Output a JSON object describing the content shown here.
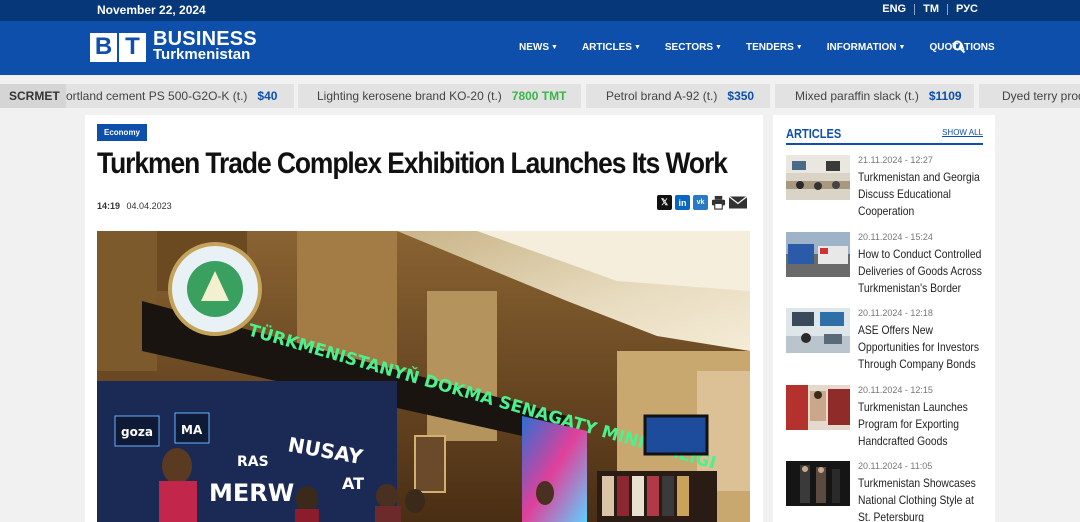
{
  "topbar": {
    "date": "November 22, 2024",
    "languages": [
      "ENG",
      "TM",
      "РУС"
    ]
  },
  "header": {
    "logo_mark": [
      "B",
      "T"
    ],
    "logo_line1": "BUSINESS",
    "logo_line2": "Turkmenistan",
    "nav": [
      {
        "label": "NEWS",
        "dropdown": true
      },
      {
        "label": "ARTICLES",
        "dropdown": true
      },
      {
        "label": "SECTORS",
        "dropdown": true
      },
      {
        "label": "TENDERS",
        "dropdown": true
      },
      {
        "label": "INFORMATION",
        "dropdown": true
      },
      {
        "label": "QUOTATIONS",
        "dropdown": false
      }
    ],
    "search_icon": "search-icon"
  },
  "ticker": {
    "label": "SCRMET",
    "items": [
      {
        "name": "ortland cement PS 500-G2O-K (t.)",
        "price": "$40",
        "color": "#0d4faa"
      },
      {
        "name": "Lighting kerosene brand KO-20 (t.)",
        "price": "7800 TMT",
        "color": "#3bb54a"
      },
      {
        "name": "Petrol brand A-92 (t.)",
        "price": "$350",
        "color": "#0d4faa"
      },
      {
        "name": "Mixed paraffin slack (t.)",
        "price": "$1109",
        "color": "#0d4faa"
      },
      {
        "name": "Dyed terry prod",
        "price": "",
        "color": "#0d4faa"
      }
    ]
  },
  "article": {
    "category": "Economy",
    "title": "Turkmen Trade Complex Exhibition Launches Its Work",
    "time": "14:19",
    "date": "04.04.2023",
    "share_icons": [
      "x-icon",
      "linkedin-icon",
      "vk-icon",
      "print-icon",
      "email-icon"
    ],
    "photo_sign": "TÜRKMENISTANYŇ DOKMA SENAGATY MINISTRLIGI",
    "photo_brands": [
      "goza",
      "MA",
      "NUSAY",
      "RAS",
      "MERW",
      "AT"
    ]
  },
  "sidebar": {
    "title": "ARTICLES",
    "show_all": "SHOW ALL",
    "items": [
      {
        "date": "21.11.2024 - 12:27",
        "title": "Turkmenistan and Georgia Discuss Educational Cooperation"
      },
      {
        "date": "20.11.2024 - 15:24",
        "title": "How to Conduct Controlled Deliveries of Goods Across Turkmenistan's Border"
      },
      {
        "date": "20.11.2024 - 12:18",
        "title": "ASE Offers New Opportunities for Investors Through Company Bonds"
      },
      {
        "date": "20.11.2024 - 12:15",
        "title": "Turkmenistan Launches Program for Exporting Handcrafted Goods"
      },
      {
        "date": "20.11.2024 - 11:05",
        "title": "Turkmenistan Showcases National Clothing Style at St. Petersburg"
      }
    ]
  },
  "colors": {
    "brand": "#0d4faa",
    "topbar": "#063779",
    "green": "#3bb54a"
  }
}
